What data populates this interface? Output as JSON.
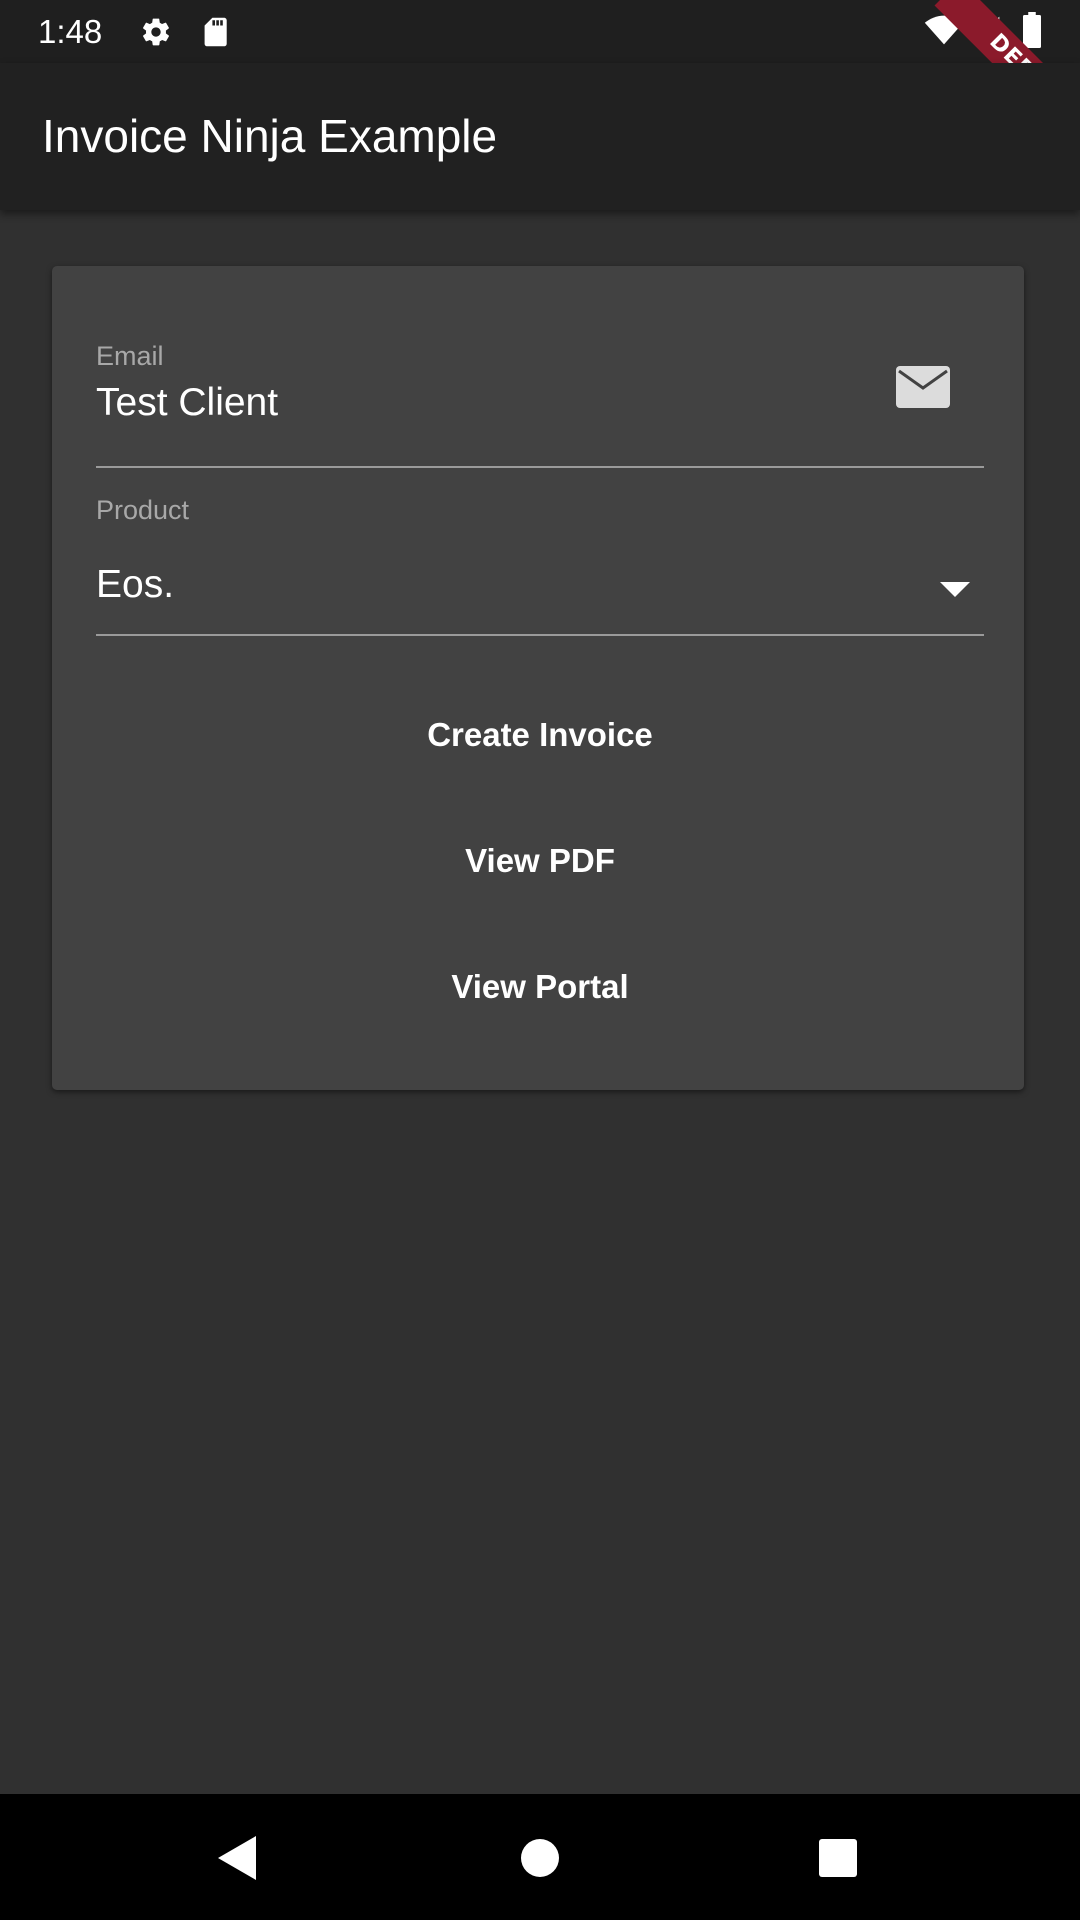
{
  "status_bar": {
    "time": "1:48",
    "icons": [
      "gear-icon",
      "sd-card-icon",
      "wifi-icon",
      "signal-icon",
      "battery-icon"
    ],
    "debug_banner": "DEBUG"
  },
  "app_bar": {
    "title": "Invoice Ninja Example"
  },
  "form": {
    "email": {
      "label": "Email",
      "value": "Test Client",
      "icon": "mail-icon"
    },
    "product": {
      "label": "Product",
      "selected": "Eos.",
      "icon": "dropdown-arrow-icon"
    }
  },
  "actions": {
    "create_invoice": "Create Invoice",
    "view_pdf": "View PDF",
    "view_portal": "View Portal"
  },
  "nav_bar": {
    "icons": [
      "back-icon",
      "home-icon",
      "recents-icon"
    ]
  },
  "colors": {
    "background": "#303030",
    "app_bar": "#212121",
    "card": "#424242",
    "debug_banner": "#8b1a2b"
  }
}
